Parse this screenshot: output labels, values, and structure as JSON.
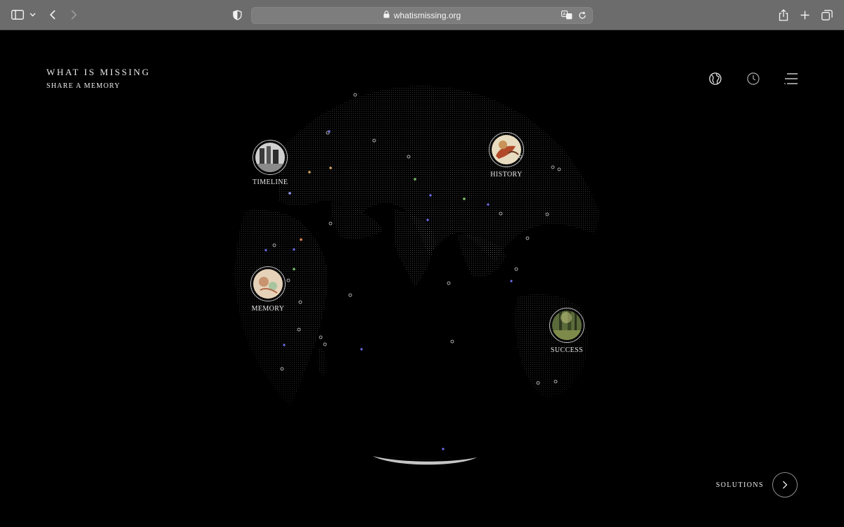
{
  "browser": {
    "url": "whatismissing.org"
  },
  "site": {
    "title": "WHAT IS MISSING",
    "subtitle": "SHARE A MEMORY"
  },
  "top_icons": [
    "globe-icon",
    "clock-icon",
    "menu-icon"
  ],
  "nodes": [
    {
      "label": "TIMELINE"
    },
    {
      "label": "HISTORY"
    },
    {
      "label": "MEMORY"
    },
    {
      "label": "SUCCESS"
    }
  ],
  "solutions": {
    "label": "SOLUTIONS"
  }
}
